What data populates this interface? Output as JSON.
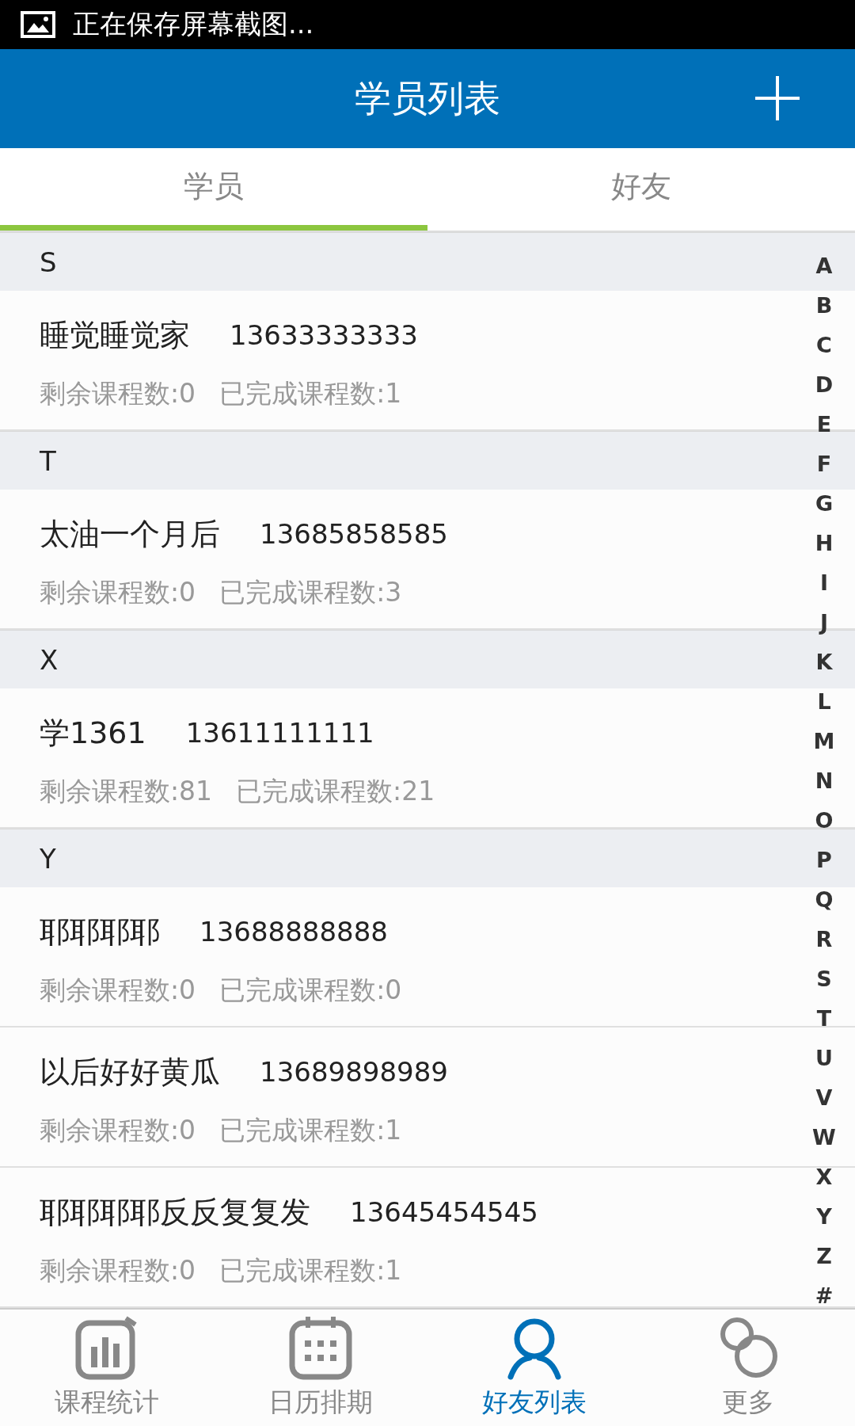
{
  "status_bar": {
    "notification": "正在保存屏幕截图..."
  },
  "header": {
    "title": "学员列表"
  },
  "tabs": [
    {
      "label": "学员",
      "selected": true
    },
    {
      "label": "好友",
      "selected": false
    }
  ],
  "sections": [
    {
      "letter": "S",
      "students": [
        {
          "name": "睡觉睡觉家",
          "phone": "13633333333",
          "remaining": "剩余课程数:0",
          "completed": "已完成课程数:1"
        }
      ]
    },
    {
      "letter": "T",
      "students": [
        {
          "name": "太油一个月后",
          "phone": "13685858585",
          "remaining": "剩余课程数:0",
          "completed": "已完成课程数:3"
        }
      ]
    },
    {
      "letter": "X",
      "students": [
        {
          "name": "学1361",
          "phone": "13611111111",
          "remaining": "剩余课程数:81",
          "completed": "已完成课程数:21"
        }
      ]
    },
    {
      "letter": "Y",
      "students": [
        {
          "name": "耶耶耶耶",
          "phone": "13688888888",
          "remaining": "剩余课程数:0",
          "completed": "已完成课程数:0"
        },
        {
          "name": "以后好好黄瓜",
          "phone": "13689898989",
          "remaining": "剩余课程数:0",
          "completed": "已完成课程数:1"
        },
        {
          "name": "耶耶耶耶反反复复发",
          "phone": "13645454545",
          "remaining": "剩余课程数:0",
          "completed": "已完成课程数:1"
        }
      ]
    }
  ],
  "index_letters": [
    "A",
    "B",
    "C",
    "D",
    "E",
    "F",
    "G",
    "H",
    "I",
    "J",
    "K",
    "L",
    "M",
    "N",
    "O",
    "P",
    "Q",
    "R",
    "S",
    "T",
    "U",
    "V",
    "W",
    "X",
    "Y",
    "Z",
    "#"
  ],
  "bottom_nav": [
    {
      "kind": "stats",
      "label": "课程统计",
      "selected": false
    },
    {
      "kind": "calendar",
      "label": "日历排期",
      "selected": false
    },
    {
      "kind": "person",
      "label": "好友列表",
      "selected": true
    },
    {
      "kind": "more",
      "label": "更多",
      "selected": false
    }
  ]
}
